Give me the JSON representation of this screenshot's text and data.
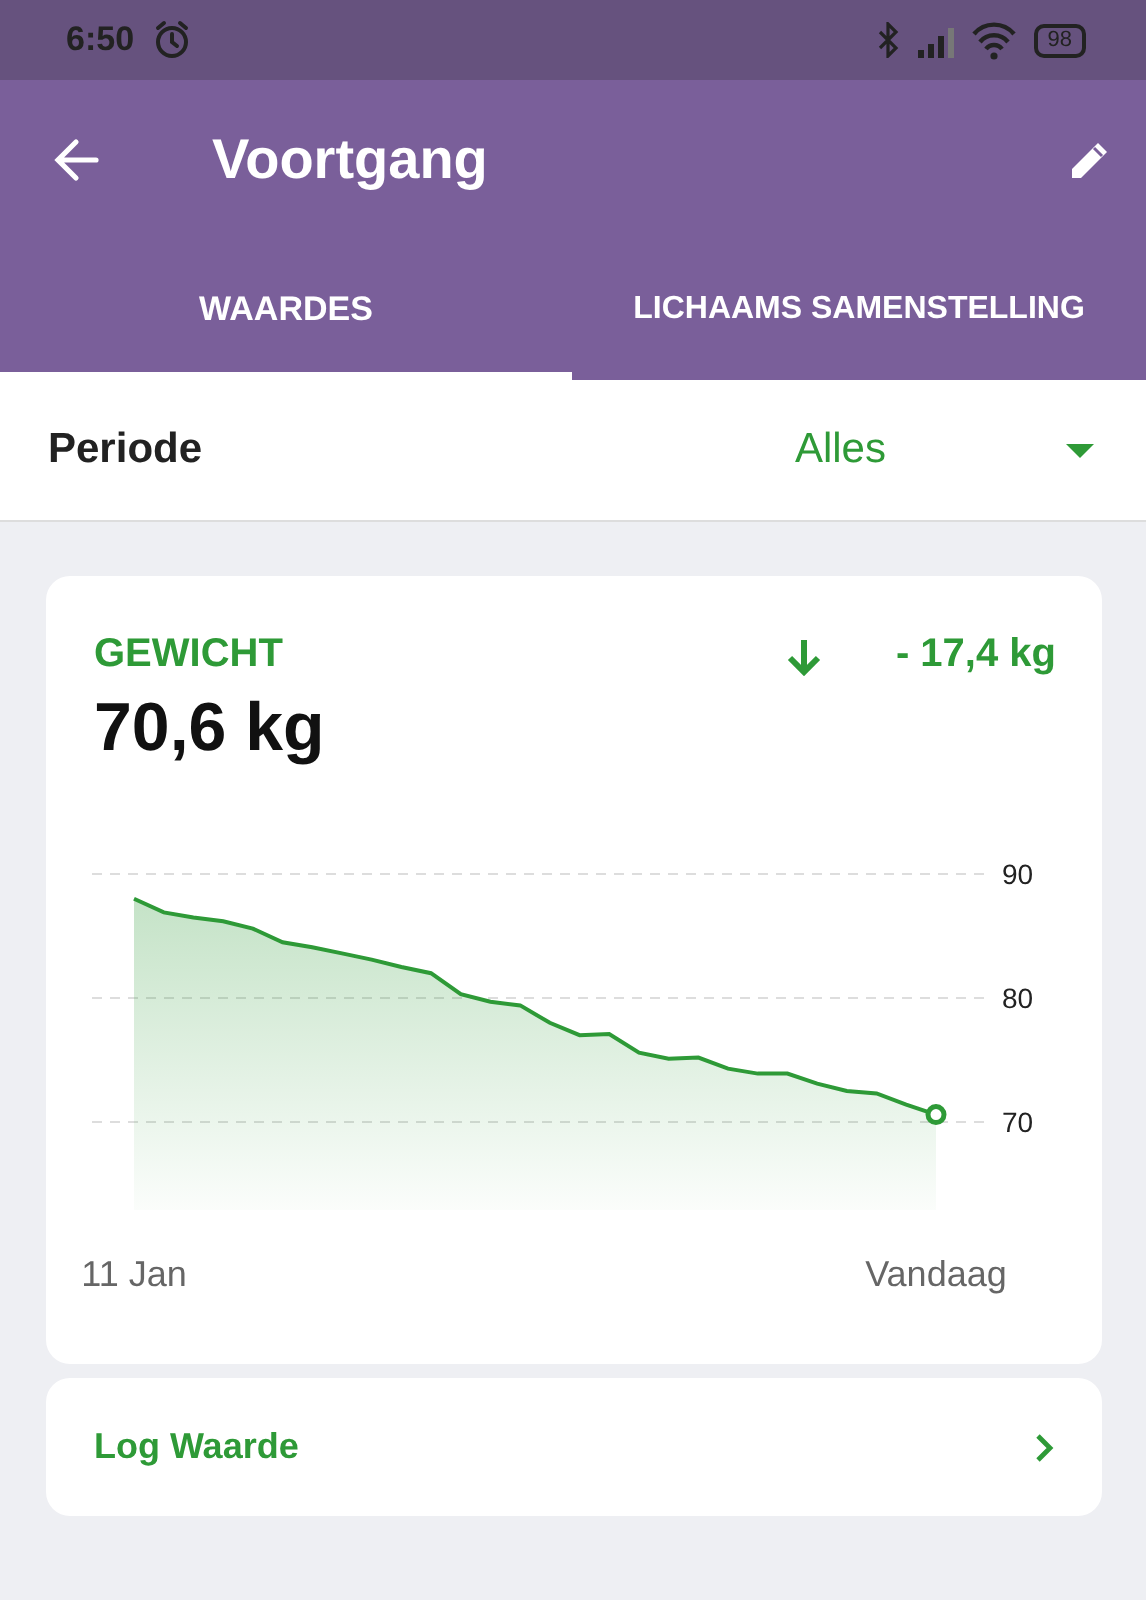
{
  "status_bar": {
    "time": "6:50",
    "battery": "98"
  },
  "app_bar": {
    "title": "Voortgang"
  },
  "tabs": [
    {
      "label": "WAARDES",
      "selected": true
    },
    {
      "label": "LICHAAMS SAMENSTELLING",
      "selected": false
    }
  ],
  "period": {
    "label": "Periode",
    "value": "Alles"
  },
  "weight_card": {
    "title": "GEWICHT",
    "value": "70,6 kg",
    "change": "- 17,4 kg",
    "chart_data": {
      "type": "area",
      "grid": true,
      "ylim": [
        70,
        90
      ],
      "yticks": [
        70,
        80,
        90
      ],
      "categories": [
        "11 Jan",
        null,
        null,
        null,
        null,
        null,
        null,
        null,
        null,
        null,
        null,
        null,
        null,
        null,
        null,
        null,
        null,
        null,
        null,
        null,
        null,
        null,
        null,
        null,
        null,
        null,
        null,
        "Vandaag"
      ],
      "series": [
        {
          "color": "#2e9a37",
          "values": [
            88.0,
            86.9,
            86.5,
            86.2,
            85.6,
            84.5,
            84.1,
            83.6,
            83.1,
            82.5,
            82.0,
            80.3,
            79.7,
            79.4,
            78.0,
            77.0,
            77.1,
            75.6,
            75.1,
            75.2,
            74.3,
            73.9,
            73.9,
            73.1,
            72.5,
            72.3,
            71.4,
            70.6
          ]
        }
      ]
    }
  },
  "log_button": {
    "label": "Log Waarde"
  }
}
